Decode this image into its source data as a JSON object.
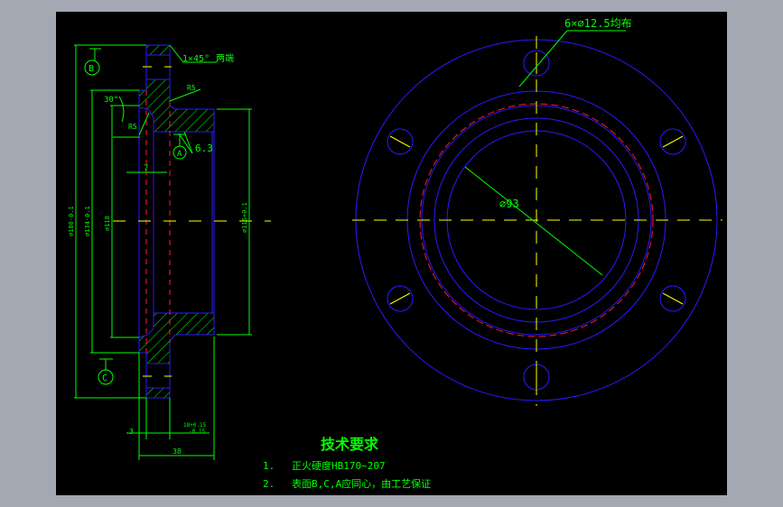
{
  "colors": {
    "background": "#000000",
    "outline": "#2a1aff",
    "dimension": "#00ff00",
    "centerline": "#ffff00",
    "hidden": "#ff1a3c",
    "frame": "#a3a8b2"
  },
  "section_view": {
    "chamfer_note": "1×45°",
    "chamfer_note_suffix": "两端",
    "datum_b": "B",
    "datum_a": "A",
    "datum_c": "C",
    "angle": "30°",
    "roughness_1": "6.3",
    "roughness_value_a": "6.3",
    "roughness_2": "R5",
    "dim_7": "7",
    "dim_d180": "⌀180-0.1",
    "dim_d134": "⌀134-0.1",
    "dim_d118": "⌀118",
    "dim_d116": "⌀116+0.1",
    "dim_3": "3",
    "dim_18": "18+0.15",
    "dim_18_lower": "-0.15",
    "dim_38": "38"
  },
  "front_view": {
    "holes_note": "6×⌀12.5均布",
    "bore_dim": "⌀93"
  },
  "tech_requirements": {
    "title": "技术要求",
    "items": [
      {
        "num": "1.",
        "text": "正火硬度HB170~207"
      },
      {
        "num": "2.",
        "text": "表面B,C,A应同心，由工艺保证"
      }
    ]
  }
}
